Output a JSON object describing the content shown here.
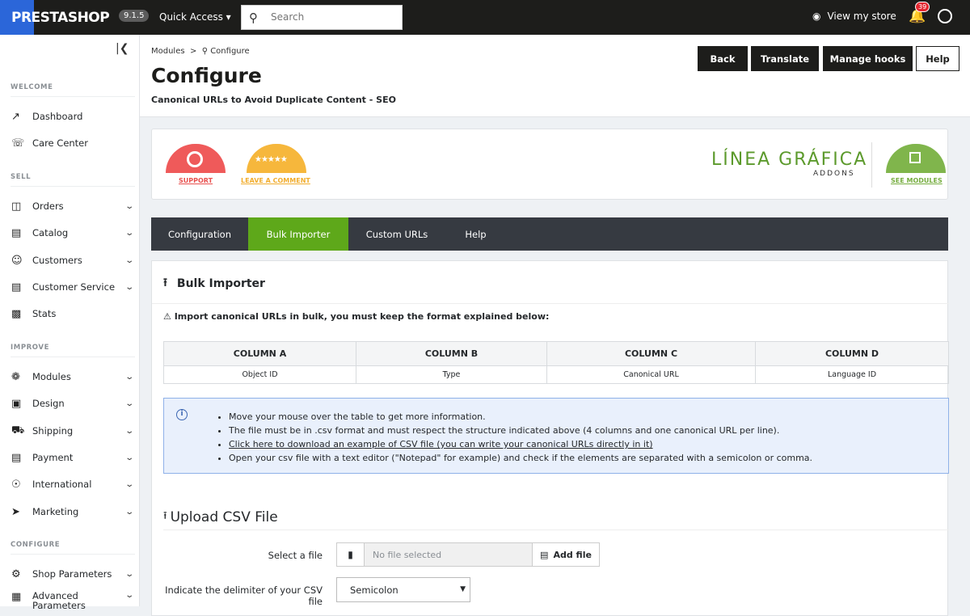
{
  "topbar": {
    "logo": "PRESTASHOP",
    "version": "9.1.5",
    "quick_access": "Quick Access",
    "search_placeholder": "Search",
    "view_store": "View my store",
    "notifications": "39"
  },
  "sidebar": {
    "sections": [
      {
        "title": "WELCOME",
        "items": [
          {
            "label": "Dashboard"
          },
          {
            "label": "Care Center"
          }
        ]
      },
      {
        "title": "SELL",
        "items": [
          {
            "label": "Orders"
          },
          {
            "label": "Catalog"
          },
          {
            "label": "Customers"
          },
          {
            "label": "Customer Service"
          },
          {
            "label": "Stats"
          }
        ]
      },
      {
        "title": "IMPROVE",
        "items": [
          {
            "label": "Modules"
          },
          {
            "label": "Design"
          },
          {
            "label": "Shipping"
          },
          {
            "label": "Payment"
          },
          {
            "label": "International"
          },
          {
            "label": "Marketing"
          }
        ]
      },
      {
        "title": "CONFIGURE",
        "items": [
          {
            "label": "Shop Parameters"
          },
          {
            "label": "Advanced Parameters"
          }
        ]
      }
    ]
  },
  "header": {
    "breadcrumb_modules": "Modules",
    "breadcrumb_sep": ">",
    "breadcrumb_current": "Configure",
    "title": "Configure",
    "subtitle": "Canonical URLs to Avoid Duplicate Content - SEO",
    "buttons": {
      "back": "Back",
      "translate": "Translate",
      "hooks": "Manage hooks",
      "help": "Help"
    }
  },
  "banner": {
    "support": "SUPPORT",
    "comment": "LEAVE A COMMENT",
    "brand": "LÍNEA GRÁFICA",
    "brand_sub": "ADDONS",
    "see_modules": "SEE MODULES",
    "colors": {
      "support": "#ef5a5a",
      "comment": "#f6b73c",
      "modules": "#80b54c"
    }
  },
  "tabs": [
    {
      "label": "Configuration"
    },
    {
      "label": "Bulk Importer"
    },
    {
      "label": "Custom URLs"
    },
    {
      "label": "Help"
    }
  ],
  "bulk": {
    "title": "Bulk Importer",
    "warning": "Import canonical URLs in bulk, you must keep the format explained below:",
    "columns": [
      "COLUMN A",
      "COLUMN B",
      "COLUMN C",
      "COLUMN D"
    ],
    "values": [
      "Object ID",
      "Type",
      "Canonical URL",
      "Language ID"
    ],
    "info": [
      "Move your mouse over the table to get more information.",
      "The file must be in .csv format and must respect the structure indicated above (4 columns and one canonical URL per line).",
      "Click here to download an example of CSV file (you can write your canonical URLs directly in it)",
      "Open your csv file with a text editor (\"Notepad\" for example) and check if the elements are separated with a semicolon or comma."
    ]
  },
  "upload": {
    "title": "Upload CSV File",
    "select_label": "Select a file",
    "file_placeholder": "No file selected",
    "add_file": "Add file",
    "delimiter_label": "Indicate the delimiter of your CSV file",
    "delimiter_value": "Semicolon"
  }
}
